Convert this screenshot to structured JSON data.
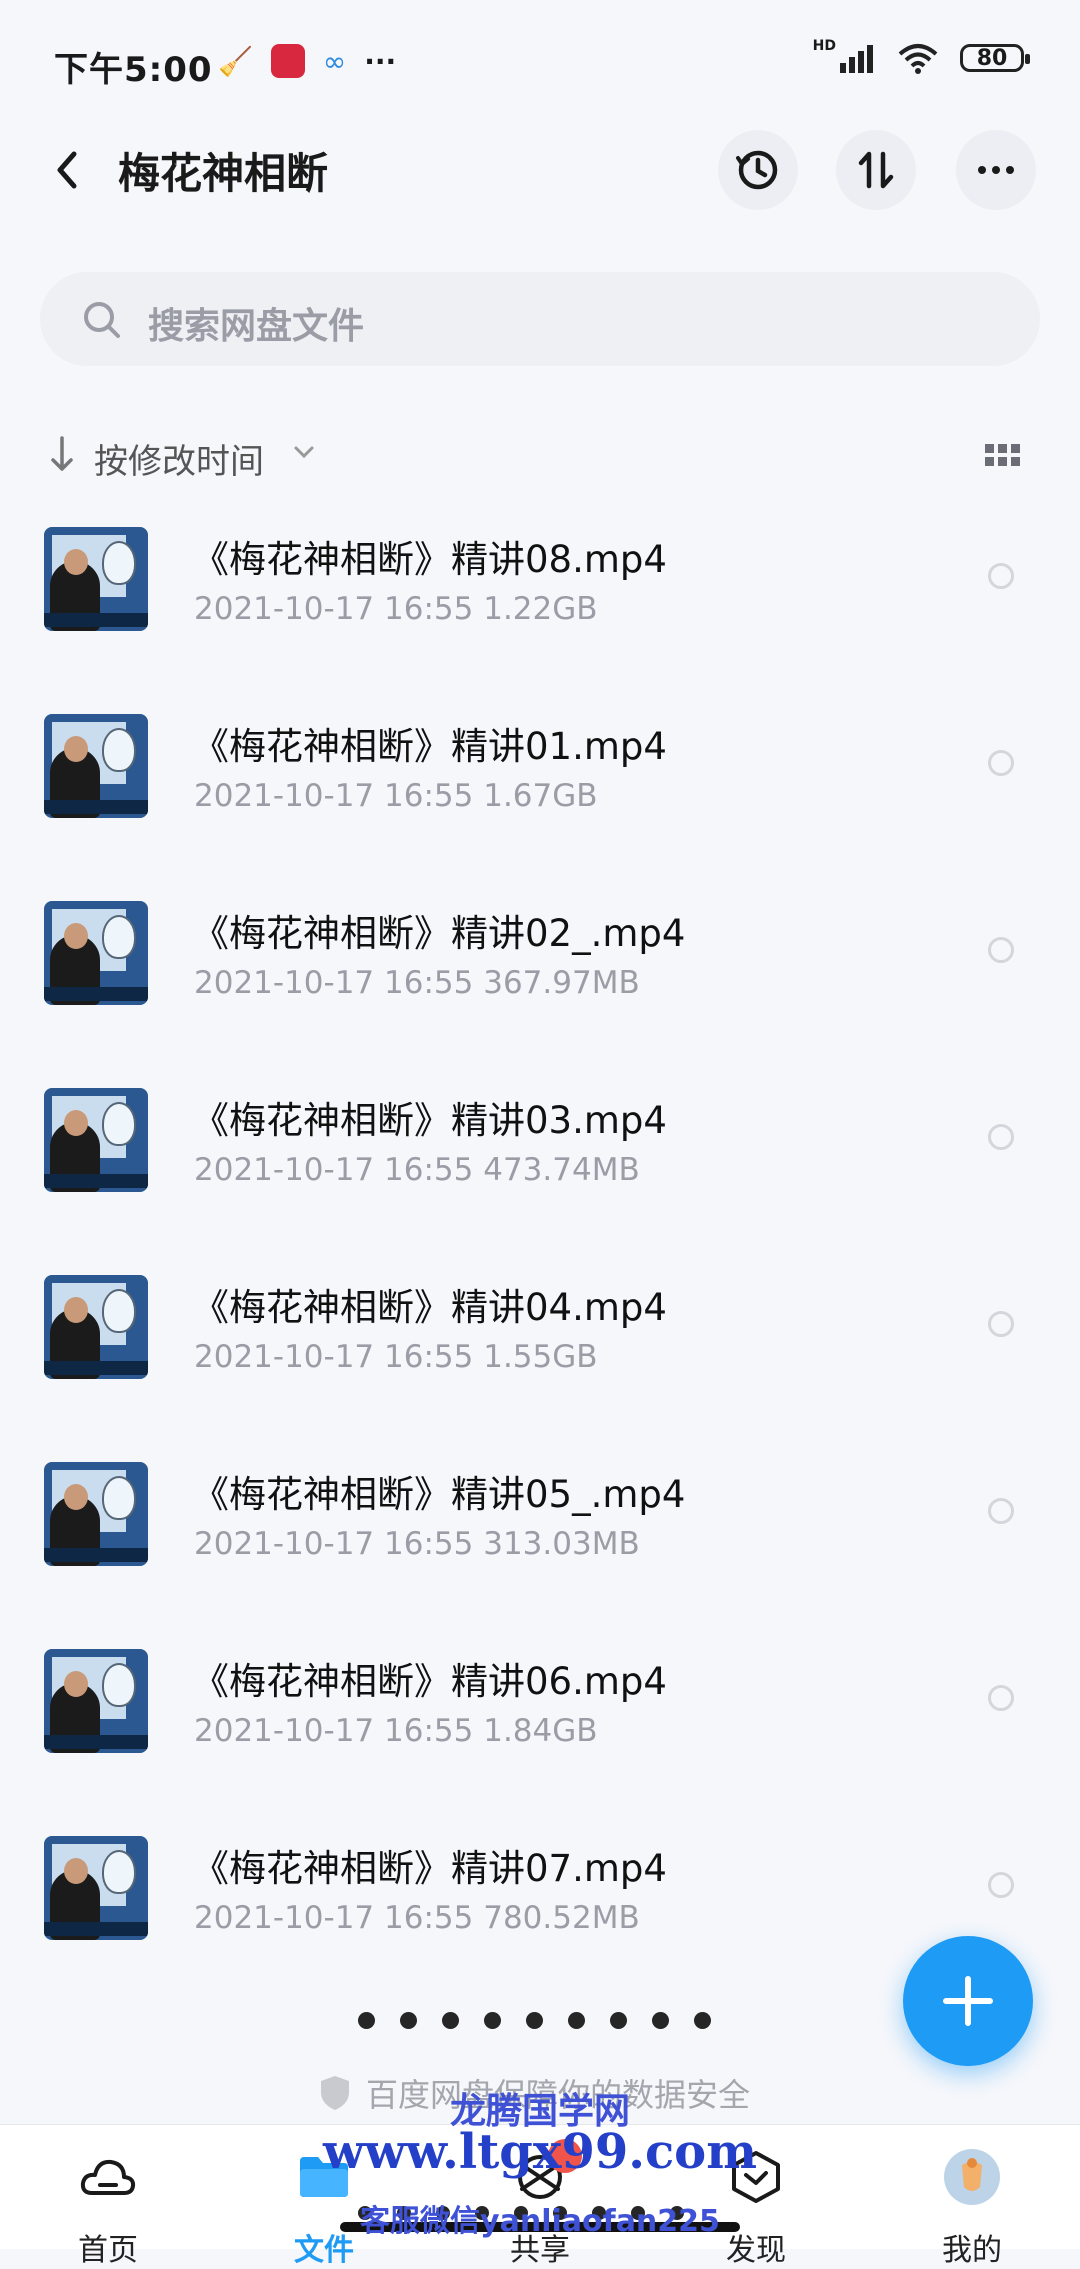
{
  "status_bar": {
    "time": "下午5:00",
    "network_label": "HD",
    "battery": "80"
  },
  "header": {
    "title": "梅花神相断"
  },
  "search": {
    "placeholder": "搜索网盘文件"
  },
  "sort": {
    "label": "按修改时间"
  },
  "files": [
    {
      "name": "《梅花神相断》精讲08.mp4",
      "date": "2021-10-17",
      "time": "16:55",
      "size": "1.22GB"
    },
    {
      "name": "《梅花神相断》精讲01.mp4",
      "date": "2021-10-17",
      "time": "16:55",
      "size": "1.67GB"
    },
    {
      "name": "《梅花神相断》精讲02_.mp4",
      "date": "2021-10-17",
      "time": "16:55",
      "size": "367.97MB"
    },
    {
      "name": "《梅花神相断》精讲03.mp4",
      "date": "2021-10-17",
      "time": "16:55",
      "size": "473.74MB"
    },
    {
      "name": "《梅花神相断》精讲04.mp4",
      "date": "2021-10-17",
      "time": "16:55",
      "size": "1.55GB"
    },
    {
      "name": "《梅花神相断》精讲05_.mp4",
      "date": "2021-10-17",
      "time": "16:55",
      "size": "313.03MB"
    },
    {
      "name": "《梅花神相断》精讲06.mp4",
      "date": "2021-10-17",
      "time": "16:55",
      "size": "1.84GB"
    },
    {
      "name": "《梅花神相断》精讲07.mp4",
      "date": "2021-10-17",
      "time": "16:55",
      "size": "780.52MB"
    }
  ],
  "footer": {
    "security_text": "百度网盘保障你的数据安全"
  },
  "tabs": [
    {
      "label": "首页",
      "icon": "cloud-icon"
    },
    {
      "label": "文件",
      "icon": "folder-icon"
    },
    {
      "label": "共享",
      "icon": "share-icon"
    },
    {
      "label": "发现",
      "icon": "discover-icon"
    },
    {
      "label": "我的",
      "icon": "avatar"
    }
  ],
  "watermark": {
    "line1": "龙腾国学网",
    "line2": "www.ltgx99.com",
    "line3": "客服微信yanliaofan225"
  },
  "colors": {
    "accent": "#1e9bf5",
    "background": "#f6f7fb",
    "badge": "#f1544a",
    "watermark": "#2440c8"
  }
}
